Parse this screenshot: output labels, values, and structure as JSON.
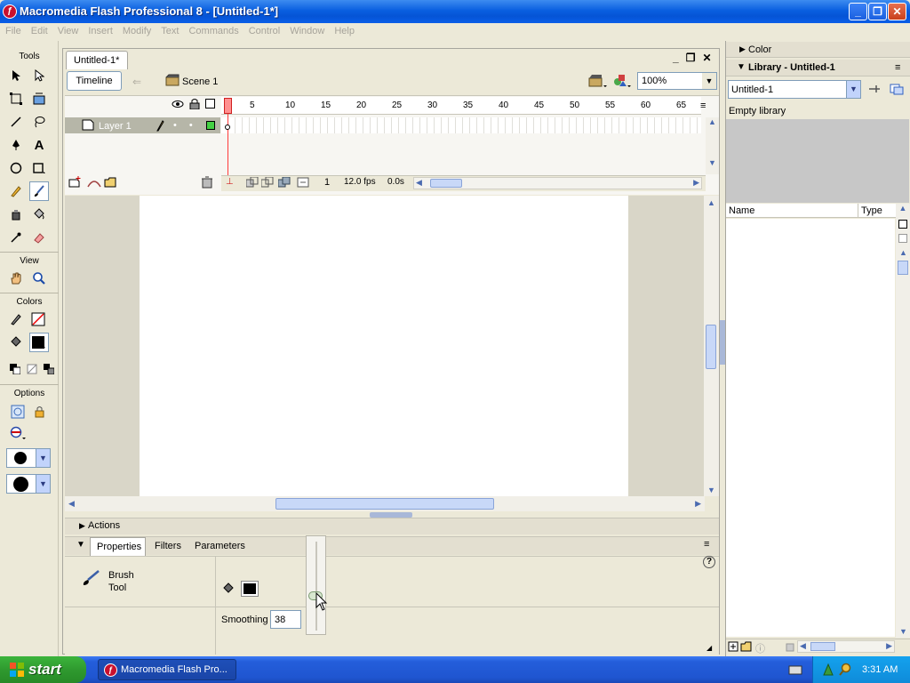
{
  "window": {
    "title": "Macromedia Flash Professional 8 - [Untitled-1*]"
  },
  "menu": [
    "File",
    "Edit",
    "View",
    "Insert",
    "Modify",
    "Text",
    "Commands",
    "Control",
    "Window",
    "Help"
  ],
  "tools": {
    "label_tools": "Tools",
    "label_view": "View",
    "label_colors": "Colors",
    "label_options": "Options"
  },
  "document": {
    "tab_label": "Untitled-1*",
    "timeline_button": "Timeline",
    "scene_label": "Scene 1",
    "zoom": "100%",
    "layer_name": "Layer 1",
    "frame_ticks": [
      "1",
      "5",
      "10",
      "15",
      "20",
      "25",
      "30",
      "35",
      "40",
      "45",
      "50",
      "55",
      "60",
      "65"
    ],
    "current_frame": "1",
    "fps": "12.0 fps",
    "elapsed": "0.0s"
  },
  "panels": {
    "actions_label": "Actions",
    "tabs": [
      "Properties",
      "Filters",
      "Parameters"
    ],
    "tool_name_line1": "Brush",
    "tool_name_line2": "Tool",
    "smoothing_label": "Smoothing",
    "smoothing_value": "38"
  },
  "right": {
    "color_panel": "Color",
    "library_panel": "Library - Untitled-1",
    "library_select": "Untitled-1",
    "empty_text": "Empty library",
    "col_name": "Name",
    "col_type": "Type"
  },
  "taskbar": {
    "start": "start",
    "app_button": "Macromedia Flash Pro...",
    "time": "3:31 AM"
  },
  "colors": {
    "accent": "#0a5fe0",
    "playhead": "#ff3b3b",
    "layer_green": "#44d044",
    "stroke": "#000000"
  }
}
